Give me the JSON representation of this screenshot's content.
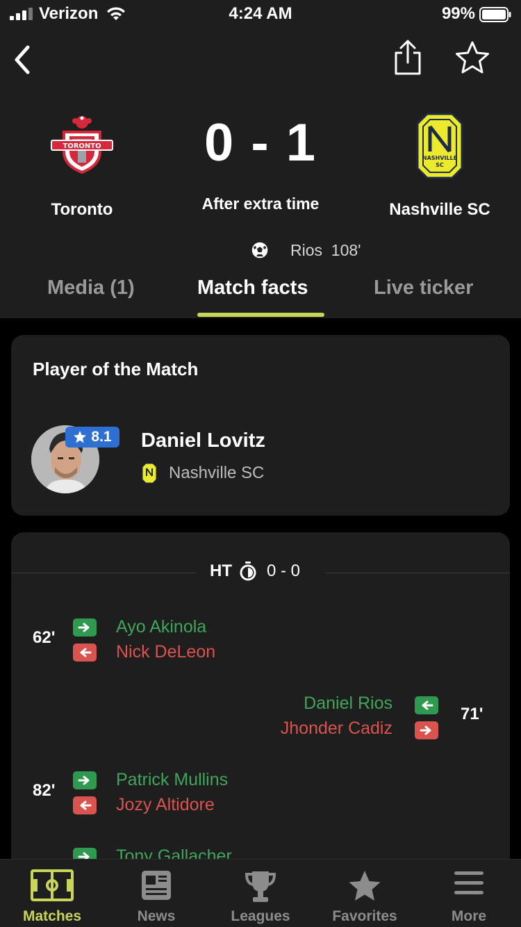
{
  "status_bar": {
    "carrier": "Verizon",
    "time": "4:24 AM",
    "battery": "99%"
  },
  "match": {
    "home_team": "Toronto",
    "away_team": "Nashville SC",
    "score": "0 - 1",
    "status": "After extra time",
    "goal": {
      "scorer": "Rios",
      "minute": "108'"
    }
  },
  "tabs": [
    {
      "label": "Media (1)"
    },
    {
      "label": "Match facts"
    },
    {
      "label": "Live ticker"
    }
  ],
  "potm": {
    "title": "Player of the Match",
    "name": "Daniel Lovitz",
    "team": "Nashville SC",
    "rating": "8.1"
  },
  "halftime": {
    "label": "HT",
    "score": "0 - 0"
  },
  "events": [
    {
      "minute": "62'",
      "side": "home",
      "in": "Ayo Akinola",
      "out": "Nick DeLeon"
    },
    {
      "minute": "71'",
      "side": "away",
      "in": "Daniel Rios",
      "out": "Jhonder Cadiz"
    },
    {
      "minute": "82'",
      "side": "home",
      "in": "Patrick Mullins",
      "out": "Jozy Altidore"
    },
    {
      "minute": "",
      "side": "home",
      "in": "Tony Gallacher",
      "out": ""
    }
  ],
  "nav": [
    {
      "label": "Matches",
      "icon": "pitch-icon"
    },
    {
      "label": "News",
      "icon": "newspaper-icon"
    },
    {
      "label": "Leagues",
      "icon": "trophy-icon"
    },
    {
      "label": "Favorites",
      "icon": "star-icon"
    },
    {
      "label": "More",
      "icon": "menu-icon"
    }
  ],
  "colors": {
    "accent": "#c8d45a",
    "sub_in": "#3fa55a",
    "sub_out": "#d9534f",
    "rating": "#2e6fd4",
    "surface": "#1e1e1e"
  }
}
